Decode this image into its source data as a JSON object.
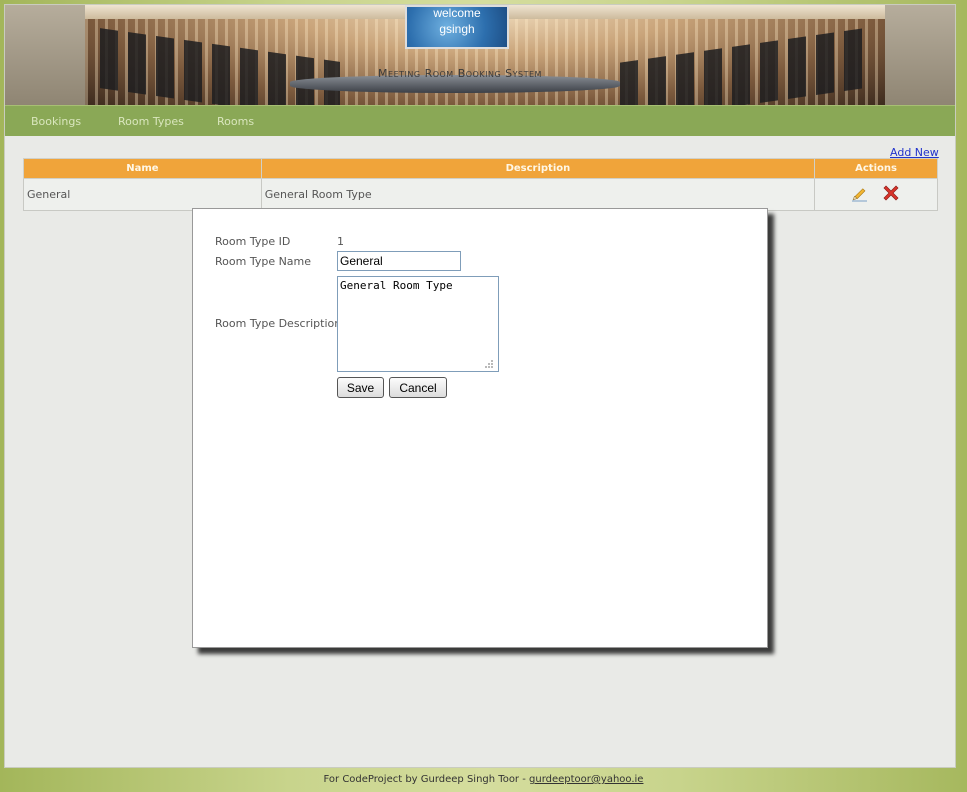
{
  "header": {
    "welcome_line1": "welcome",
    "welcome_line2": "gsingh",
    "title": "Meeting Room Booking System"
  },
  "nav": {
    "items": [
      {
        "label": "Bookings"
      },
      {
        "label": "Room Types"
      },
      {
        "label": "Rooms"
      }
    ]
  },
  "toolbar": {
    "add_new": "Add New"
  },
  "table": {
    "columns": [
      "Name",
      "Description",
      "Actions"
    ],
    "rows": [
      {
        "name": "General",
        "description": "General Room Type",
        "actions": [
          "edit-icon",
          "delete-icon"
        ]
      }
    ]
  },
  "dialog": {
    "id_label": "Room Type ID",
    "id_value": "1",
    "name_label": "Room Type Name",
    "name_value": "General",
    "description_label": "Room Type Description",
    "description_value": "General Room Type",
    "save_label": "Save",
    "cancel_label": "Cancel"
  },
  "footer": {
    "text": "For CodeProject by Gurdeep Singh Toor - ",
    "email": "gurdeeptoor@yahoo.ie"
  },
  "colors": {
    "nav_bg": "#8aa856",
    "table_header_bg": "#f0a43a",
    "link": "#2233cc",
    "delete_red": "#d9342b"
  }
}
